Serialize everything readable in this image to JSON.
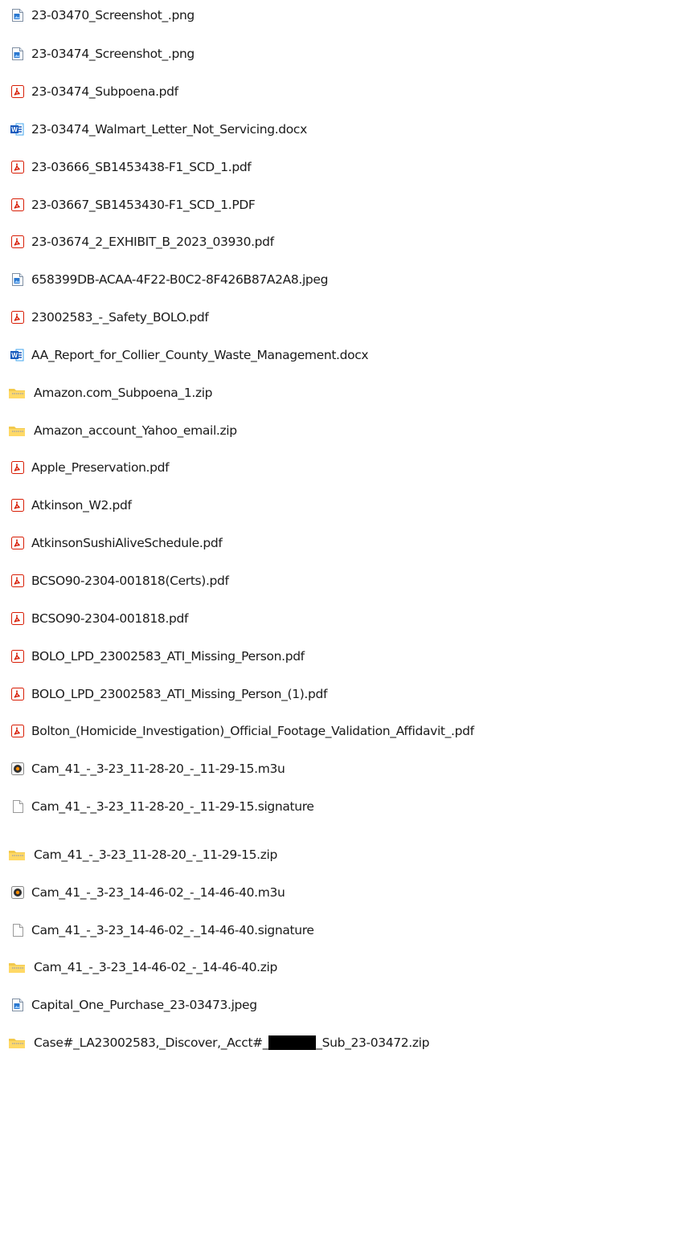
{
  "files": [
    {
      "name": "23-03470_Screenshot_.png",
      "type": "image"
    },
    {
      "name": "23-03474_Screenshot_.png",
      "type": "image"
    },
    {
      "name": "23-03474_Subpoena.pdf",
      "type": "pdf"
    },
    {
      "name": "23-03474_Walmart_Letter_Not_Servicing.docx",
      "type": "word"
    },
    {
      "name": "23-03666_SB1453438-F1_SCD_1.pdf",
      "type": "pdf"
    },
    {
      "name": "23-03667_SB1453430-F1_SCD_1.PDF",
      "type": "pdf"
    },
    {
      "name": "23-03674_2_EXHIBIT_B_2023_03930.pdf",
      "type": "pdf"
    },
    {
      "name": "658399DB-ACAA-4F22-B0C2-8F426B87A2A8.jpeg",
      "type": "image"
    },
    {
      "name": "23002583_-_Safety_BOLO.pdf",
      "type": "pdf"
    },
    {
      "name": "AA_Report_for_Collier_County_Waste_Management.docx",
      "type": "word"
    },
    {
      "name": "Amazon.com_Subpoena_1.zip",
      "type": "zip"
    },
    {
      "name": "Amazon_account_Yahoo_email.zip",
      "type": "zip"
    },
    {
      "name": "Apple_Preservation.pdf",
      "type": "pdf"
    },
    {
      "name": "Atkinson_W2.pdf",
      "type": "pdf"
    },
    {
      "name": "AtkinsonSushiAliveSchedule.pdf",
      "type": "pdf"
    },
    {
      "name": "BCSO90-2304-001818(Certs).pdf",
      "type": "pdf"
    },
    {
      "name": "BCSO90-2304-001818.pdf",
      "type": "pdf"
    },
    {
      "name": "BOLO_LPD_23002583_ATI_Missing_Person.pdf",
      "type": "pdf"
    },
    {
      "name": "BOLO_LPD_23002583_ATI_Missing_Person_(1).pdf",
      "type": "pdf"
    },
    {
      "name": "Bolton_(Homicide_Investigation)_Official_Footage_Validation_Affidavit_.pdf",
      "type": "pdf"
    },
    {
      "name": "Cam_41_-_3-23_11-28-20_-_11-29-15.m3u",
      "type": "playlist"
    },
    {
      "name": "Cam_41_-_3-23_11-28-20_-_11-29-15.signature",
      "type": "blank"
    },
    {
      "name": "Cam_41_-_3-23_11-28-20_-_11-29-15.zip",
      "type": "zip"
    },
    {
      "name": "Cam_41_-_3-23_14-46-02_-_14-46-40.m3u",
      "type": "playlist"
    },
    {
      "name": "Cam_41_-_3-23_14-46-02_-_14-46-40.signature",
      "type": "blank"
    },
    {
      "name": "Cam_41_-_3-23_14-46-02_-_14-46-40.zip",
      "type": "zip"
    },
    {
      "name": "Capital_One_Purchase_23-03473.jpeg",
      "type": "image"
    },
    {
      "name_prefix": "Case#_LA23002583,_Discover,_Acct#_",
      "name_suffix": "_Sub_23-03472.zip",
      "type": "zip",
      "redacted": true
    }
  ],
  "icons": {
    "image": "image-file-icon",
    "pdf": "pdf-file-icon",
    "word": "word-document-icon",
    "zip": "zip-folder-icon",
    "playlist": "media-playlist-icon",
    "blank": "blank-file-icon"
  },
  "colors": {
    "pdf_red": "#d81e06",
    "word_blue": "#185abd",
    "zip_yellow": "#f2c94c",
    "image_blue": "#2b78d0",
    "text": "#1a1a1a"
  }
}
